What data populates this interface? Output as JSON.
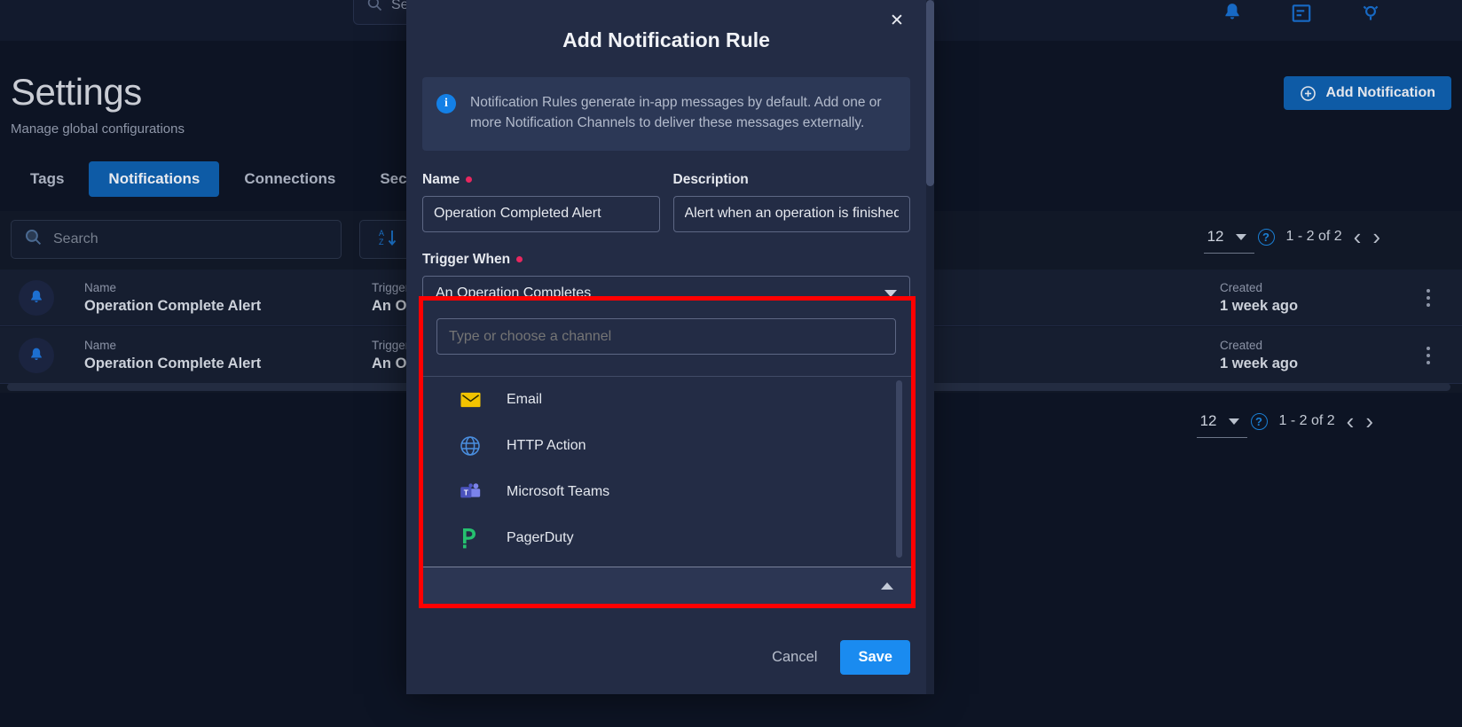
{
  "topbar": {
    "search_placeholder": "Search",
    "icons": [
      "bell-icon",
      "notes-icon",
      "help-icon"
    ]
  },
  "page": {
    "title": "Settings",
    "subtitle": "Manage global configurations",
    "add_button": "Add Notification",
    "tabs": [
      {
        "label": "Tags",
        "active": false
      },
      {
        "label": "Notifications",
        "active": true
      },
      {
        "label": "Connections",
        "active": false
      },
      {
        "label": "Security",
        "active": false
      }
    ]
  },
  "toolbar": {
    "search_placeholder": "Search",
    "sort_icon": "sort-az-icon"
  },
  "pagination": {
    "page_size": "12",
    "range": "1 - 2 of 2",
    "prev_icon": "chevron-left-icon",
    "next_icon": "chevron-right-icon",
    "help_icon": "question-icon"
  },
  "rows": [
    {
      "icon": "bell-icon",
      "name_label": "Name",
      "name_value": "Operation Complete Alert",
      "trigger_label": "Trigger When",
      "trigger_value": "An Operation",
      "created_label": "Created",
      "created_value": "1 week ago",
      "menu_icon": "kebab-menu-icon"
    },
    {
      "icon": "bell-icon",
      "name_label": "Name",
      "name_value": "Operation Complete Alert",
      "trigger_label": "Trigger When",
      "trigger_value": "An Operation",
      "created_label": "Created",
      "created_value": "1 week ago",
      "menu_icon": "kebab-menu-icon"
    }
  ],
  "modal": {
    "title": "Add Notification Rule",
    "close_icon": "close-icon",
    "info": {
      "icon": "info-icon",
      "text": "Notification Rules generate in-app messages by default. Add one or more Notification Channels to deliver these messages externally."
    },
    "name": {
      "label": "Name",
      "required": true,
      "value": "Operation Completed Alert",
      "placeholder": "Name"
    },
    "description": {
      "label": "Description",
      "required": false,
      "value": "Alert when an operation is finished",
      "placeholder": "Description"
    },
    "trigger": {
      "label": "Trigger When",
      "required": true,
      "value": "An Operation Completes"
    },
    "channel": {
      "input_placeholder": "Type or choose a channel",
      "input_value": "",
      "collapse_icon": "chevron-up-icon",
      "options": [
        {
          "label": "Email",
          "icon": "email-icon"
        },
        {
          "label": "HTTP Action",
          "icon": "globe-icon"
        },
        {
          "label": "Microsoft Teams",
          "icon": "microsoft-teams-icon"
        },
        {
          "label": "PagerDuty",
          "icon": "pagerduty-icon"
        }
      ]
    },
    "cancel_label": "Cancel",
    "save_label": "Save"
  },
  "colors": {
    "accent_blue": "#0e5ba6",
    "save_blue": "#1a8bf0",
    "required_red": "#e8275f",
    "highlight_red": "#ff0000",
    "modal_bg": "#232c45",
    "page_bg": "#0d1424"
  }
}
